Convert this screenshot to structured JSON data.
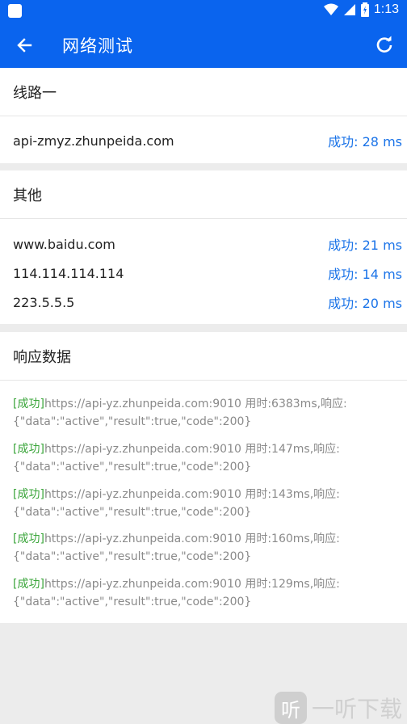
{
  "status_bar": {
    "time": "1:13"
  },
  "app_bar": {
    "title": "网络测试",
    "back_icon": "arrow-left-icon",
    "refresh_icon": "refresh-icon"
  },
  "route1": {
    "heading": "线路一",
    "rows": [
      {
        "host": "api-zmyz.zhunpeida.com",
        "result": "成功: 28 ms"
      }
    ]
  },
  "other": {
    "heading": "其他",
    "rows": [
      {
        "host": "www.baidu.com",
        "result": "成功: 21 ms"
      },
      {
        "host": "114.114.114.114",
        "result": "成功: 14 ms"
      },
      {
        "host": "223.5.5.5",
        "result": "成功: 20 ms"
      }
    ]
  },
  "responses": {
    "heading": "响应数据",
    "entries": [
      {
        "tag": "[成功]",
        "line1": "https://api-yz.zhunpeida.com:9010 用时:6383ms,响应:",
        "line2": "{\"data\":\"active\",\"result\":true,\"code\":200}"
      },
      {
        "tag": "[成功]",
        "line1": "https://api-yz.zhunpeida.com:9010 用时:147ms,响应:",
        "line2": "{\"data\":\"active\",\"result\":true,\"code\":200}"
      },
      {
        "tag": "[成功]",
        "line1": "https://api-yz.zhunpeida.com:9010 用时:143ms,响应:",
        "line2": "{\"data\":\"active\",\"result\":true,\"code\":200}"
      },
      {
        "tag": "[成功]",
        "line1": "https://api-yz.zhunpeida.com:9010 用时:160ms,响应:",
        "line2": "{\"data\":\"active\",\"result\":true,\"code\":200}"
      },
      {
        "tag": "[成功]",
        "line1": "https://api-yz.zhunpeida.com:9010 用时:129ms,响应:",
        "line2": "{\"data\":\"active\",\"result\":true,\"code\":200}"
      }
    ]
  },
  "watermark": {
    "icon_text": "听",
    "text": "一听下载"
  },
  "colors": {
    "primary": "#0a64ee",
    "success_blue": "#1a73e8",
    "success_green": "#3aa53a"
  }
}
